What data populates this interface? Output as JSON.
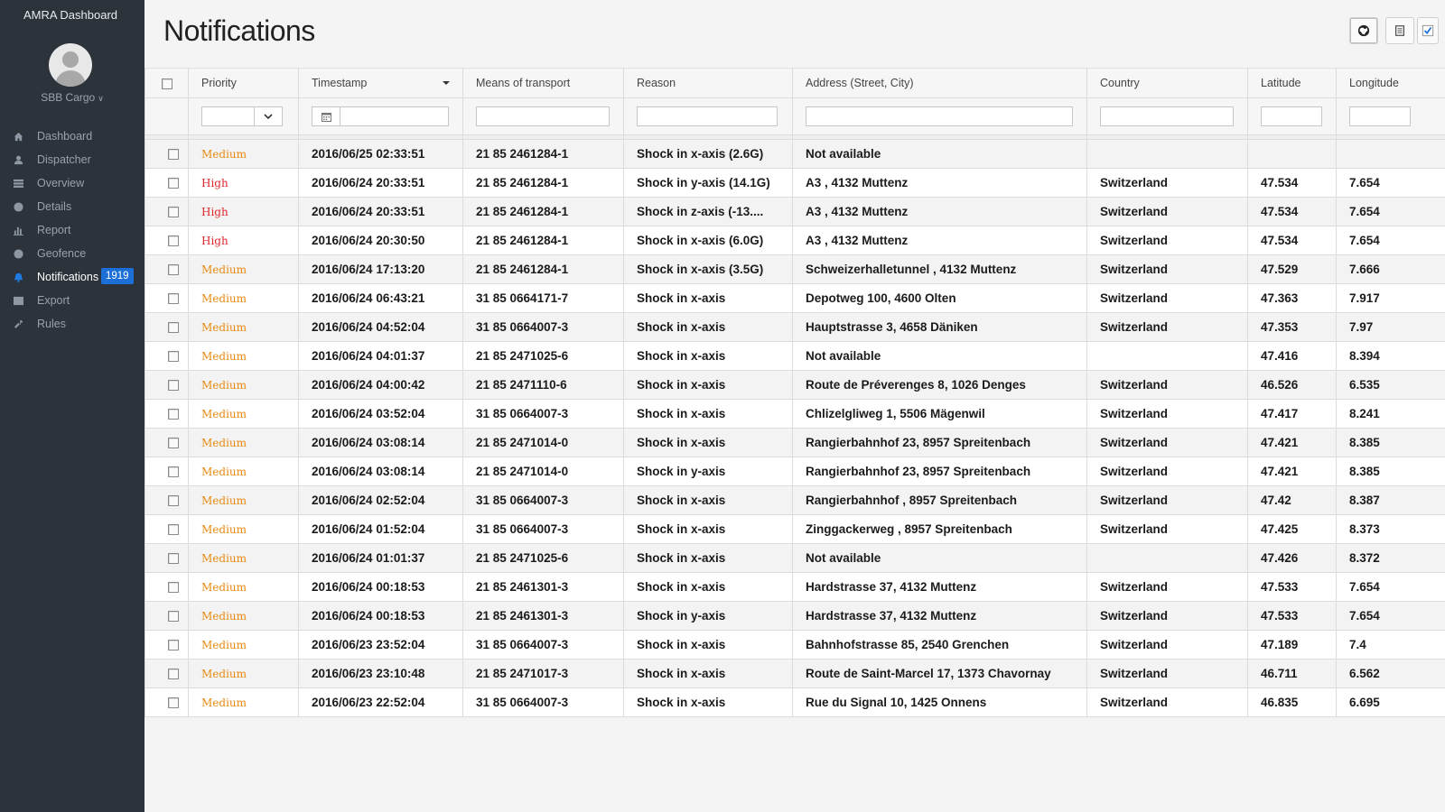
{
  "app": {
    "title": "AMRA Dashboard",
    "company": "SBB Cargo"
  },
  "sidebar": {
    "items": [
      {
        "label": "Dashboard",
        "icon": "home-icon"
      },
      {
        "label": "Dispatcher",
        "icon": "user-icon"
      },
      {
        "label": "Overview",
        "icon": "grid-icon"
      },
      {
        "label": "Details",
        "icon": "info-icon"
      },
      {
        "label": "Report",
        "icon": "bar-chart-icon"
      },
      {
        "label": "Geofence",
        "icon": "globe-icon"
      },
      {
        "label": "Notifications",
        "icon": "bell-icon",
        "badge": "1919",
        "active": true
      },
      {
        "label": "Export",
        "icon": "table-icon"
      },
      {
        "label": "Rules",
        "icon": "wrench-icon"
      }
    ]
  },
  "page": {
    "title": "Notifications"
  },
  "toolbar": {
    "buttons": [
      "globe-icon",
      "document-icon",
      "checkmark-icon"
    ]
  },
  "table": {
    "columns": [
      "Priority",
      "Timestamp",
      "Means of transport",
      "Reason",
      "Address (Street, City)",
      "Country",
      "Latitude",
      "Longitude"
    ],
    "sorted_column": "Timestamp",
    "priority_colors": {
      "High": "#e0262b",
      "Medium": "#e88a10"
    },
    "rows": [
      [
        "Medium",
        "2016/06/25 02:33:51",
        "21 85 2461284-1",
        "Shock in x-axis (2.6G)",
        "Not available",
        "",
        "",
        ""
      ],
      [
        "High",
        "2016/06/24 20:33:51",
        "21 85 2461284-1",
        "Shock in y-axis (14.1G)",
        "A3 , 4132 Muttenz",
        "Switzerland",
        "47.534",
        "7.654"
      ],
      [
        "High",
        "2016/06/24 20:33:51",
        "21 85 2461284-1",
        "Shock in z-axis (-13....",
        "A3 , 4132 Muttenz",
        "Switzerland",
        "47.534",
        "7.654"
      ],
      [
        "High",
        "2016/06/24 20:30:50",
        "21 85 2461284-1",
        "Shock in x-axis (6.0G)",
        "A3 , 4132 Muttenz",
        "Switzerland",
        "47.534",
        "7.654"
      ],
      [
        "Medium",
        "2016/06/24 17:13:20",
        "21 85 2461284-1",
        "Shock in x-axis (3.5G)",
        "Schweizerhalletunnel , 4132 Muttenz",
        "Switzerland",
        "47.529",
        "7.666"
      ],
      [
        "Medium",
        "2016/06/24 06:43:21",
        "31 85 0664171-7",
        "Shock in x-axis",
        "Depotweg 100, 4600 Olten",
        "Switzerland",
        "47.363",
        "7.917"
      ],
      [
        "Medium",
        "2016/06/24 04:52:04",
        "31 85 0664007-3",
        "Shock in x-axis",
        "Hauptstrasse 3, 4658 Däniken",
        "Switzerland",
        "47.353",
        "7.97"
      ],
      [
        "Medium",
        "2016/06/24 04:01:37",
        "21 85 2471025-6",
        "Shock in x-axis",
        "Not available",
        "",
        "47.416",
        "8.394"
      ],
      [
        "Medium",
        "2016/06/24 04:00:42",
        "21 85 2471110-6",
        "Shock in x-axis",
        "Route de Préverenges 8, 1026 Denges",
        "Switzerland",
        "46.526",
        "6.535"
      ],
      [
        "Medium",
        "2016/06/24 03:52:04",
        "31 85 0664007-3",
        "Shock in x-axis",
        "Chlizelgliweg 1, 5506 Mägenwil",
        "Switzerland",
        "47.417",
        "8.241"
      ],
      [
        "Medium",
        "2016/06/24 03:08:14",
        "21 85 2471014-0",
        "Shock in x-axis",
        "Rangierbahnhof 23, 8957 Spreitenbach",
        "Switzerland",
        "47.421",
        "8.385"
      ],
      [
        "Medium",
        "2016/06/24 03:08:14",
        "21 85 2471014-0",
        "Shock in y-axis",
        "Rangierbahnhof 23, 8957 Spreitenbach",
        "Switzerland",
        "47.421",
        "8.385"
      ],
      [
        "Medium",
        "2016/06/24 02:52:04",
        "31 85 0664007-3",
        "Shock in x-axis",
        "Rangierbahnhof , 8957 Spreitenbach",
        "Switzerland",
        "47.42",
        "8.387"
      ],
      [
        "Medium",
        "2016/06/24 01:52:04",
        "31 85 0664007-3",
        "Shock in x-axis",
        "Zinggackerweg , 8957 Spreitenbach",
        "Switzerland",
        "47.425",
        "8.373"
      ],
      [
        "Medium",
        "2016/06/24 01:01:37",
        "21 85 2471025-6",
        "Shock in x-axis",
        "Not available",
        "",
        "47.426",
        "8.372"
      ],
      [
        "Medium",
        "2016/06/24 00:18:53",
        "21 85 2461301-3",
        "Shock in x-axis",
        "Hardstrasse 37, 4132 Muttenz",
        "Switzerland",
        "47.533",
        "7.654"
      ],
      [
        "Medium",
        "2016/06/24 00:18:53",
        "21 85 2461301-3",
        "Shock in y-axis",
        "Hardstrasse 37, 4132 Muttenz",
        "Switzerland",
        "47.533",
        "7.654"
      ],
      [
        "Medium",
        "2016/06/23 23:52:04",
        "31 85 0664007-3",
        "Shock in x-axis",
        "Bahnhofstrasse 85, 2540 Grenchen",
        "Switzerland",
        "47.189",
        "7.4"
      ],
      [
        "Medium",
        "2016/06/23 23:10:48",
        "21 85 2471017-3",
        "Shock in x-axis",
        "Route de Saint-Marcel 17, 1373 Chavornay",
        "Switzerland",
        "46.711",
        "6.562"
      ],
      [
        "Medium",
        "2016/06/23 22:52:04",
        "31 85 0664007-3",
        "Shock in x-axis",
        "Rue du Signal 10, 1425 Onnens",
        "Switzerland",
        "46.835",
        "6.695"
      ]
    ]
  }
}
